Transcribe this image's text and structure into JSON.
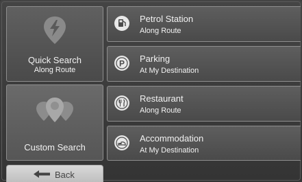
{
  "left_panel": {
    "quick_search": {
      "label": "Quick Search",
      "sublabel": "Along Route",
      "icon": "lightning-pin-icon"
    },
    "custom_search": {
      "label": "Custom Search",
      "icon": "multi-pin-icon"
    }
  },
  "results": [
    {
      "title": "Petrol Station",
      "subtitle": "Along Route",
      "icon": "fuel-pump-icon"
    },
    {
      "title": "Parking",
      "subtitle": "At My Destination",
      "icon": "parking-icon"
    },
    {
      "title": "Restaurant",
      "subtitle": "Along Route",
      "icon": "fork-knife-icon"
    },
    {
      "title": "Accommodation",
      "subtitle": "At My Destination",
      "icon": "bed-icon"
    }
  ],
  "back_button": {
    "label": "Back",
    "icon": "back-arrow-icon"
  }
}
